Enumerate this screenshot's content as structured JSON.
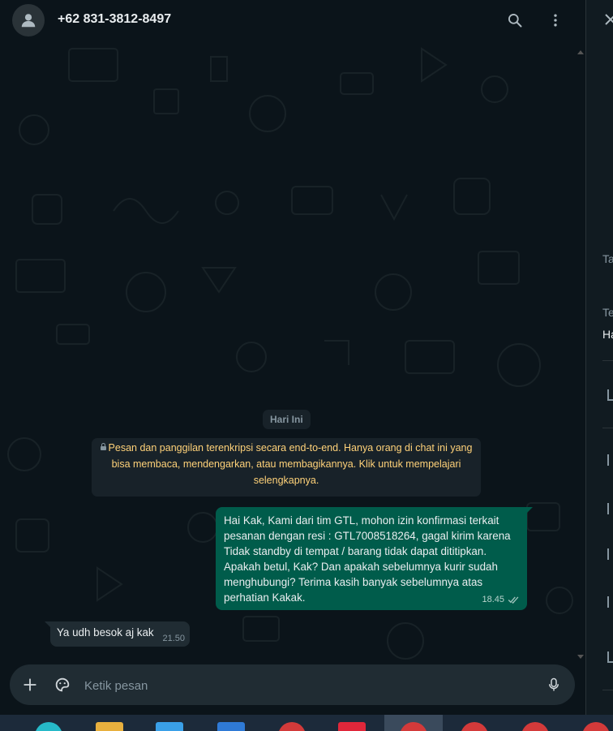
{
  "header": {
    "contact_name": "+62 831-3812-8497",
    "icons": [
      "person-icon",
      "search-icon",
      "more-vertical-icon"
    ]
  },
  "chat": {
    "date_chip": "Hari Ini",
    "encryption_notice": "Pesan dan panggilan terenkripsi secara end-to-end. Hanya orang di chat ini yang bisa membaca, mendengarkan, atau membagikannya. Klik untuk mempelajari selengkapnya.",
    "messages": [
      {
        "direction": "outgoing",
        "text": "Hai Kak, Kami dari tim GTL, mohon izin konfirmasi terkait pesanan dengan resi : GTL7008518264, gagal kirim karena Tidak standby di tempat / barang tidak dapat dititipkan. Apakah betul, Kak? Dan apakah sebelumnya kurir sudah menghubungi? Terima kasih banyak sebelumnya atas perhatian Kakak.",
        "time": "18.45",
        "status": "read"
      },
      {
        "direction": "incoming",
        "text": "Ya udh besok aj kak",
        "time": "21.50"
      }
    ]
  },
  "composer": {
    "placeholder": "Ketik pesan",
    "icons": [
      "plus-icon",
      "sticker-icon",
      "microphone-icon"
    ]
  },
  "side_panel": {
    "close_icon": "close-icon",
    "label_1": "Ta",
    "label_2": "Te",
    "value_2": "Ha"
  },
  "colors": {
    "background": "#0b141a",
    "outgoing_bubble": "#005c4b",
    "incoming_bubble": "#202c33",
    "notice_text": "#ffd279"
  }
}
